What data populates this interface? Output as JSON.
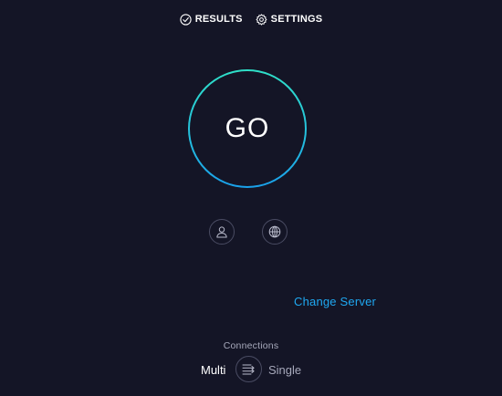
{
  "nav": {
    "results_label": "RESULTS",
    "settings_label": "SETTINGS",
    "results_icon": "check-circle-icon",
    "settings_icon": "gear-icon"
  },
  "start": {
    "go_label": "GO"
  },
  "icons": {
    "user": "user-icon",
    "globe": "globe-icon"
  },
  "server": {
    "change_label": "Change Server"
  },
  "connections": {
    "title": "Connections",
    "multi_label": "Multi",
    "single_label": "Single",
    "toggle_icon": "connections-toggle-icon"
  },
  "colors": {
    "background": "#141526",
    "accent_link": "#1fa8f1",
    "ring_top": "#2fe0c8",
    "ring_bottom": "#1aa0ea",
    "muted_text": "#a7a9bb"
  }
}
